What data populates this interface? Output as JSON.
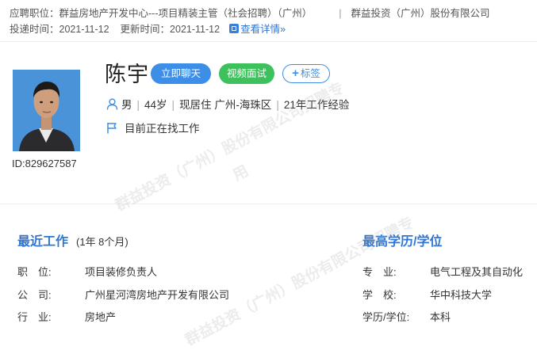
{
  "header": {
    "position_label": "应聘职位：",
    "position_value": "群益房地产开发中心---项目精装主管（社会招聘）（广州）",
    "separator": "|",
    "company": "群益投资（广州）股份有限公司",
    "submit_label": "投递时间：",
    "submit_date": "2021-11-12",
    "update_label": "更新时间：",
    "update_date": "2021-11-12",
    "detail_link": "查看详情»"
  },
  "candidate": {
    "name": "陈宇",
    "id": "ID:829627587",
    "gender": "男",
    "age": "44岁",
    "residence": "现居住 广州-海珠区",
    "experience": "21年工作经验",
    "status": "目前正在找工作"
  },
  "actions": {
    "chat": "立即聊天",
    "video": "视频面试",
    "tag_plus": "+",
    "tag": "标签"
  },
  "recent_work": {
    "title": "最近工作",
    "duration": "(1年 8个月)",
    "rows": [
      {
        "label": "职　位:",
        "value": "项目装修负责人"
      },
      {
        "label": "公　司:",
        "value": "广州星河湾房地产开发有限公司"
      },
      {
        "label": "行　业:",
        "value": "房地产"
      }
    ]
  },
  "education": {
    "title": "最高学历/学位",
    "rows": [
      {
        "label": "专　业:",
        "value": "电气工程及其自动化"
      },
      {
        "label": "学　校:",
        "value": "华中科技大学"
      },
      {
        "label": "学历/学位:",
        "value": "本科"
      }
    ]
  },
  "watermark": {
    "line1": "群益投资（广州）股份有限公司招聘专",
    "line2": "用"
  },
  "colors": {
    "accent": "#3d8ee6",
    "video": "#3ec15c",
    "link": "#2f76d2"
  }
}
